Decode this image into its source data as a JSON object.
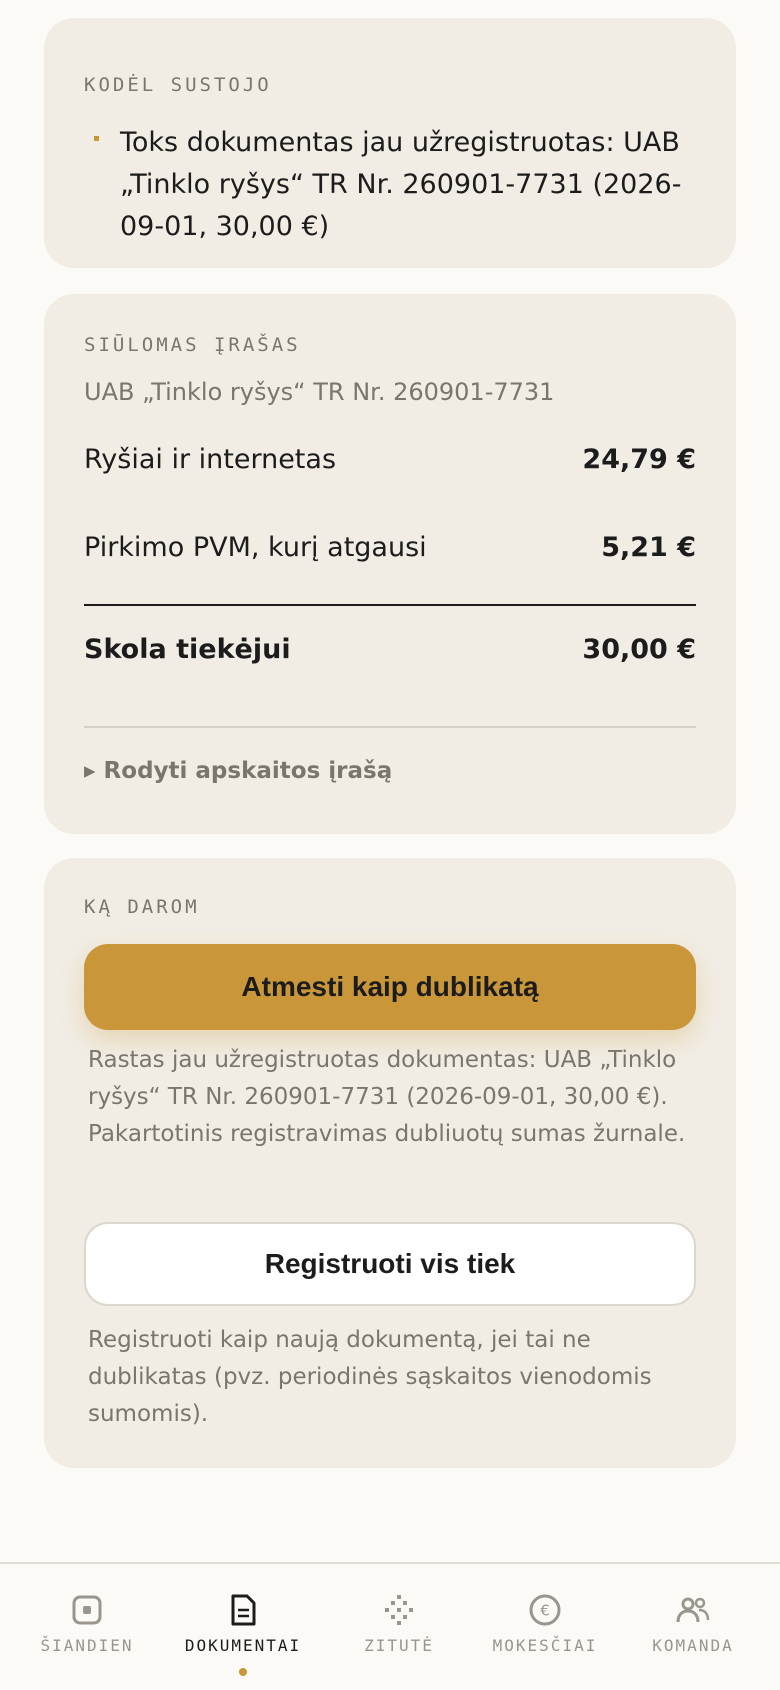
{
  "duplicate_card": {
    "heading": "KODĖL SUSTOJO",
    "reason": "Toks dokumentas jau užregistruotas: UAB „Tinklo ryšys“ TR Nr. 260901-7731 (2026-09-01, 30,00 €)"
  },
  "proposed_card": {
    "heading": "SIŪLOMAS ĮRAŠAS",
    "supplier": "UAB „Tinklo ryšys“ TR Nr. 260901-7731",
    "lines": [
      {
        "label": "Ryšiai ir internetas",
        "amount": "24,79 €"
      },
      {
        "label": "Pirkimo PVM, kurį atgausi",
        "amount": "5,21 €"
      }
    ],
    "total": {
      "label": "Skola tiekėjui",
      "amount": "30,00 €"
    },
    "toggle": "▸ Rodyti apskaitos įrašą"
  },
  "action_card": {
    "heading": "KĄ DAROM",
    "primary_label": "Atmesti kaip dublikatą",
    "primary_desc": "Rastas jau užregistruotas dokumentas: UAB „Tinklo ryšys“ TR Nr. 260901-7731 (2026-09-01, 30,00 €). Pakartotinis registravimas dubliuotų sumas žurnale.",
    "secondary_label": "Registruoti vis tiek",
    "secondary_desc": "Registruoti kaip naują dokumentą, jei tai ne dublikatas (pvz. periodinės sąskaitos vienodomis sumomis)."
  },
  "tabbar": {
    "active": "dokumentai",
    "tabs": [
      {
        "label": "ŠIANDIEN",
        "icon": "today-icon"
      },
      {
        "label": "DOKUMENTAI",
        "icon": "document-icon"
      },
      {
        "label": "ZITUTĖ",
        "icon": "sparkle-icon"
      },
      {
        "label": "MOKESČIAI",
        "icon": "euro-icon"
      },
      {
        "label": "KOMANDA",
        "icon": "team-icon"
      }
    ]
  },
  "colors": {
    "accent": "#c9963a",
    "card": "#f1ede4",
    "background": "#fbfaf7",
    "muted": "#7a756d"
  }
}
